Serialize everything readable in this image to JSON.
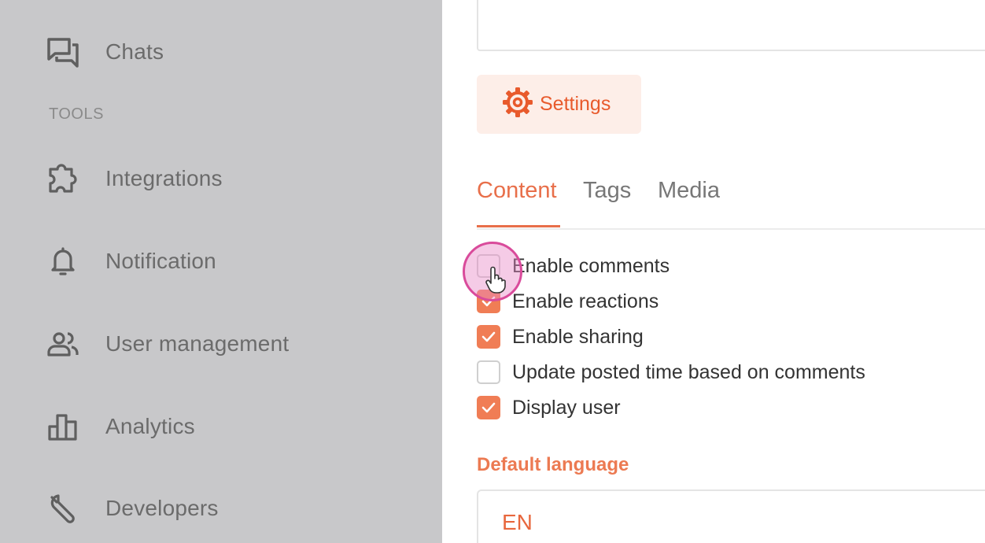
{
  "sidebar": {
    "chats_label": "Chats",
    "section_tools": "TOOLS",
    "integrations_label": "Integrations",
    "notification_label": "Notification",
    "user_management_label": "User management",
    "analytics_label": "Analytics",
    "developers_label": "Developers"
  },
  "main": {
    "settings_button": "Settings",
    "tabs": [
      {
        "label": "Content",
        "active": true
      },
      {
        "label": "Tags",
        "active": false
      },
      {
        "label": "Media",
        "active": false
      }
    ],
    "options": [
      {
        "label": "Enable comments",
        "checked": false
      },
      {
        "label": "Enable reactions",
        "checked": true
      },
      {
        "label": "Enable sharing",
        "checked": true
      },
      {
        "label": "Update posted time based on comments",
        "checked": false
      },
      {
        "label": "Display user",
        "checked": true
      }
    ],
    "default_language_title": "Default language",
    "default_language_value": "EN"
  },
  "colors": {
    "accent": "#e86f4a",
    "sidebar_bg": "#c8c8ca",
    "checkbox_checked": "#f07d55"
  },
  "icons": {
    "chats": "chat-bubbles-icon",
    "integrations": "puzzle-icon",
    "notification": "bell-icon",
    "user_management": "users-icon",
    "analytics": "bar-chart-icon",
    "developers": "wrench-icon",
    "settings": "gear-icon",
    "check": "checkmark-icon"
  }
}
